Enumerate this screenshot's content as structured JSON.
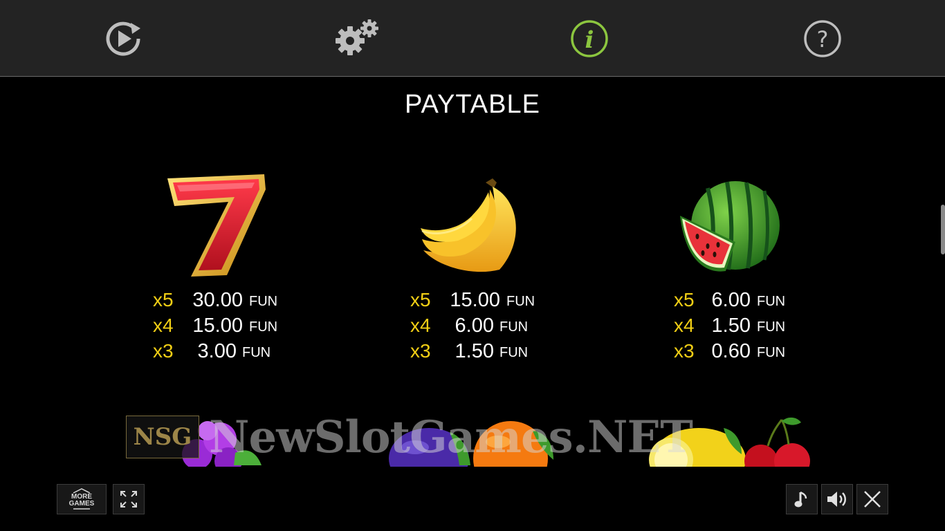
{
  "toolbar": {
    "autoplay_icon": "autoplay-icon",
    "settings_icon": "gears-icon",
    "info_icon": "info-icon",
    "help_icon": "help-icon",
    "active_color": "#8cc63f"
  },
  "page": {
    "title": "PAYTABLE"
  },
  "paytable": [
    {
      "symbol": "seven-icon",
      "rows": [
        {
          "mult": "x5",
          "amount": "30.00",
          "unit": "FUN"
        },
        {
          "mult": "x4",
          "amount": "15.00",
          "unit": "FUN"
        },
        {
          "mult": "x3",
          "amount": "3.00",
          "unit": "FUN"
        }
      ]
    },
    {
      "symbol": "banana-icon",
      "rows": [
        {
          "mult": "x5",
          "amount": "15.00",
          "unit": "FUN"
        },
        {
          "mult": "x4",
          "amount": "6.00",
          "unit": "FUN"
        },
        {
          "mult": "x3",
          "amount": "1.50",
          "unit": "FUN"
        }
      ]
    },
    {
      "symbol": "watermelon-icon",
      "rows": [
        {
          "mult": "x5",
          "amount": "6.00",
          "unit": "FUN"
        },
        {
          "mult": "x4",
          "amount": "1.50",
          "unit": "FUN"
        },
        {
          "mult": "x3",
          "amount": "0.60",
          "unit": "FUN"
        }
      ]
    }
  ],
  "watermark": {
    "logo": "NSG",
    "text": "NewSlotGames.NET"
  },
  "bottom": {
    "more_games_line1": "MORE",
    "more_games_line2": "GAMES",
    "fullscreen_icon": "fullscreen-icon",
    "music_icon": "music-icon",
    "sound_icon": "sound-icon",
    "close_icon": "close-icon"
  },
  "colors": {
    "multiplier": "#f2cf15",
    "background": "#000000",
    "topbar": "#232323"
  }
}
